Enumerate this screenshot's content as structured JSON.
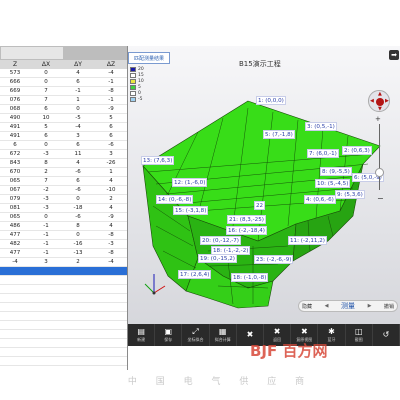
{
  "left_panel": {
    "tabs": [
      "",
      ""
    ],
    "columns": [
      "Z",
      "ΔX",
      "ΔY",
      "ΔZ"
    ],
    "rows": [
      [
        "573",
        "0",
        "4",
        "-4"
      ],
      [
        "666",
        "0",
        "6",
        "-1"
      ],
      [
        "669",
        "7",
        "-1",
        "-8"
      ],
      [
        "076",
        "7",
        "1",
        "-1"
      ],
      [
        "068",
        "6",
        "0",
        "-9"
      ],
      [
        "490",
        "10",
        "-5",
        "5"
      ],
      [
        "491",
        "5",
        "-4",
        "6"
      ],
      [
        "491",
        "6",
        "3",
        "6"
      ],
      [
        "6",
        "0",
        "6",
        "-6"
      ],
      [
        "672",
        "-3",
        "11",
        "3"
      ],
      [
        "843",
        "8",
        "4",
        "-26"
      ],
      [
        "670",
        "2",
        "-6",
        "1"
      ],
      [
        "065",
        "7",
        "6",
        "4"
      ],
      [
        "067",
        "-2",
        "-6",
        "-10"
      ],
      [
        "079",
        "-3",
        "0",
        "2"
      ],
      [
        "081",
        "-3",
        "-18",
        "4"
      ],
      [
        "065",
        "0",
        "-6",
        "-9"
      ],
      [
        "486",
        "-1",
        "8",
        "4"
      ],
      [
        "477",
        "-1",
        "0",
        "-8"
      ],
      [
        "482",
        "-1",
        "-16",
        "-3"
      ],
      [
        "477",
        "-1",
        "-13",
        "-8"
      ],
      [
        "-4",
        "3",
        "2",
        "-4"
      ]
    ],
    "selected_row_index": 22
  },
  "viewer": {
    "title": "B15演示工程",
    "tab_label": "匹配测量结果",
    "legend": [
      {
        "label": "20",
        "color": "#1a1aa8"
      },
      {
        "label": "15",
        "color": "#ffffff"
      },
      {
        "label": "10",
        "color": "#e8e840"
      },
      {
        "label": "5",
        "color": "#40d040"
      },
      {
        "label": "0",
        "color": "#ffffff"
      },
      {
        "label": "-5",
        "color": "#a0d0f0"
      }
    ],
    "points": [
      {
        "text": "1: (0,0,0)"
      },
      {
        "text": "3: (0,5,-1)"
      },
      {
        "text": "5: (7,-1,8)"
      },
      {
        "text": "2: (0,6,3)"
      },
      {
        "text": "7: (6,0,-1)"
      },
      {
        "text": "13: (7,6,3)"
      },
      {
        "text": "8: (9,-5,5)"
      },
      {
        "text": "6: (5,0,-9)"
      },
      {
        "text": "10: (5,-4,5)"
      },
      {
        "text": "12: (1,-6,0)"
      },
      {
        "text": "9: (5,3,6)"
      },
      {
        "text": "4: (0,6,-6)"
      },
      {
        "text": "14: (0,-6,-8)"
      },
      {
        "text": "15: (-3,1,8)"
      },
      {
        "text": "22"
      },
      {
        "text": "21: (8,3,-25)"
      },
      {
        "text": "16: (-2,-18,4)"
      },
      {
        "text": "20: (0,-12,-7)"
      },
      {
        "text": "18: (-1,-2,-2)"
      },
      {
        "text": "11: (-2,11,2)"
      },
      {
        "text": "19: (0,-15,2)"
      },
      {
        "text": "23: (-2,-6,-9)"
      },
      {
        "text": "17: (2,6,4)"
      },
      {
        "text": "18: (-1,0,-8)"
      }
    ],
    "mode": {
      "left": "隐藏",
      "main": "测量",
      "right": "撤销"
    },
    "export_icon": "export-arrow-icon"
  },
  "toolbar": [
    {
      "icon": "new-file-icon",
      "glyph": "▤",
      "label": "新建"
    },
    {
      "icon": "save-icon",
      "glyph": "▣",
      "label": "保存"
    },
    {
      "icon": "fit-icon",
      "glyph": "⤢",
      "label": "坐标拟合"
    },
    {
      "icon": "calc-icon",
      "glyph": "▦",
      "label": "拟合计算"
    },
    {
      "icon": "cross-icon",
      "glyph": "✖",
      "label": ""
    },
    {
      "icon": "cross-icon",
      "glyph": "✖",
      "label": "返回"
    },
    {
      "icon": "cross-icon",
      "glyph": "✖",
      "label": "复原视图"
    },
    {
      "icon": "bluetooth-icon",
      "glyph": "✱",
      "label": "蓝牙"
    },
    {
      "icon": "screenshot-icon",
      "glyph": "◫",
      "label": "截图"
    },
    {
      "icon": "back-icon",
      "glyph": "↺",
      "label": ""
    }
  ],
  "watermark": {
    "logo_text": "BJF 百方网",
    "subtitle": "中 国 电 气 供 应 商"
  }
}
